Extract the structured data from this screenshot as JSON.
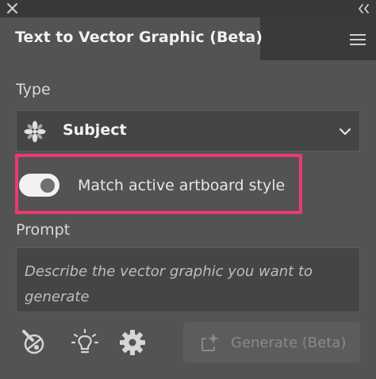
{
  "panel": {
    "title": "Text to Vector Graphic (Beta)"
  },
  "type_section": {
    "label": "Type",
    "selected": "Subject",
    "icon": "subject-icon"
  },
  "toggle": {
    "label": "Match active artboard style",
    "state": "on"
  },
  "prompt_section": {
    "label": "Prompt",
    "placeholder": "Describe the vector graphic you want to generate"
  },
  "footer": {
    "tools": [
      "style-picker-icon",
      "lightbulb-icon",
      "gear-icon"
    ],
    "generate_label": "Generate (Beta)",
    "generate_enabled": false
  },
  "colors": {
    "panel_bg": "#535353",
    "highlight": "#ec3b6e",
    "field_bg": "#454545"
  }
}
